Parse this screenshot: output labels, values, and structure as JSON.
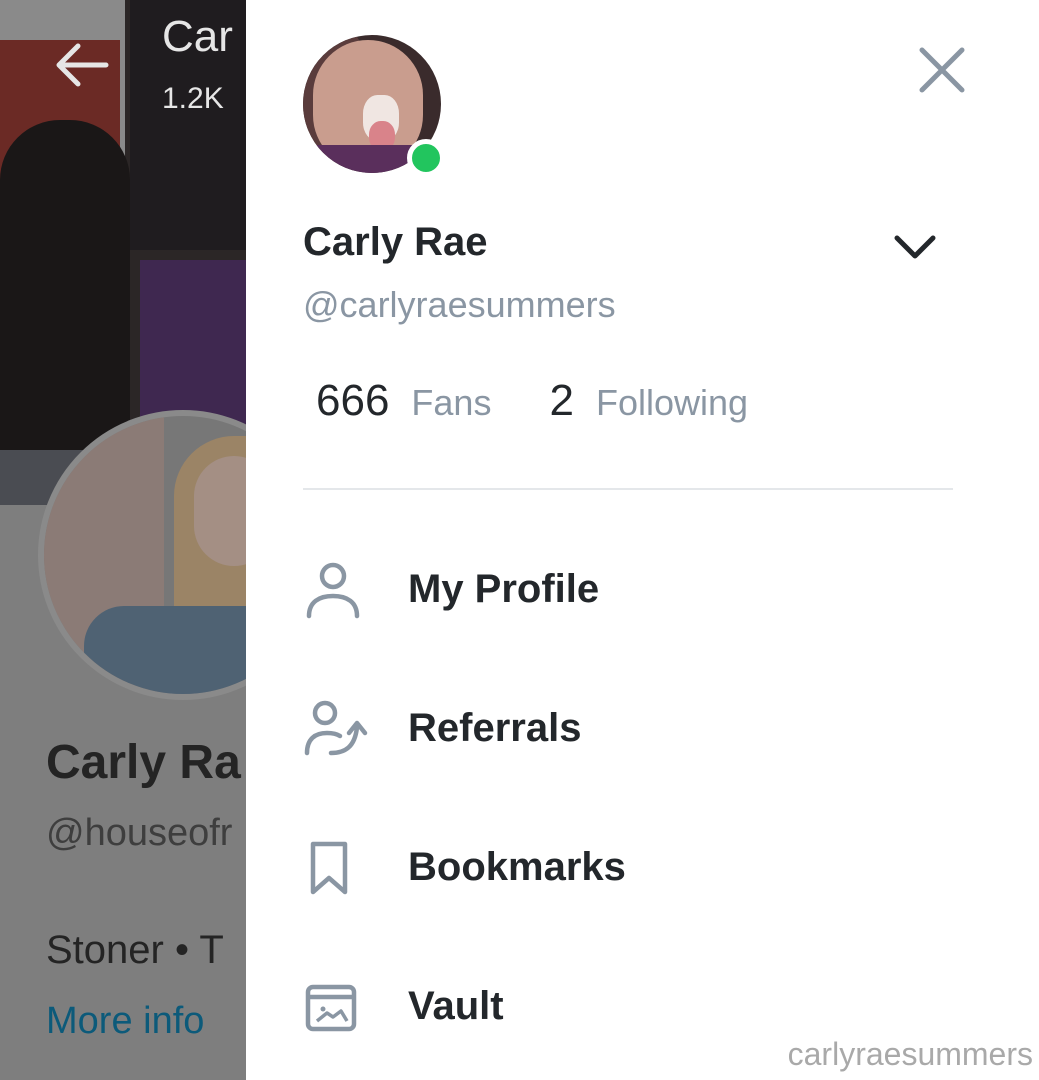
{
  "background_page": {
    "header_name": "Car",
    "header_stats": "1.2K",
    "profile_name": "Carly Ra",
    "profile_handle": "@houseofr",
    "bio": "Stoner • T",
    "more_info": "More info"
  },
  "drawer": {
    "user": {
      "name": "Carly Rae",
      "handle": "@carlyraesummers",
      "online_status_color": "#22c55e"
    },
    "stats": {
      "fans_count": "666",
      "fans_label": "Fans",
      "following_count": "2",
      "following_label": "Following"
    },
    "menu": [
      {
        "label": "My Profile",
        "icon": "user-icon"
      },
      {
        "label": "Referrals",
        "icon": "referrals-icon"
      },
      {
        "label": "Bookmarks",
        "icon": "bookmark-icon"
      },
      {
        "label": "Vault",
        "icon": "vault-icon"
      }
    ]
  },
  "watermark": "carlyraesummers",
  "colors": {
    "icon_gray": "#8a96a3",
    "text_dark": "#23272b",
    "online_green": "#22c55e",
    "link_blue": "#0c5a7a"
  }
}
